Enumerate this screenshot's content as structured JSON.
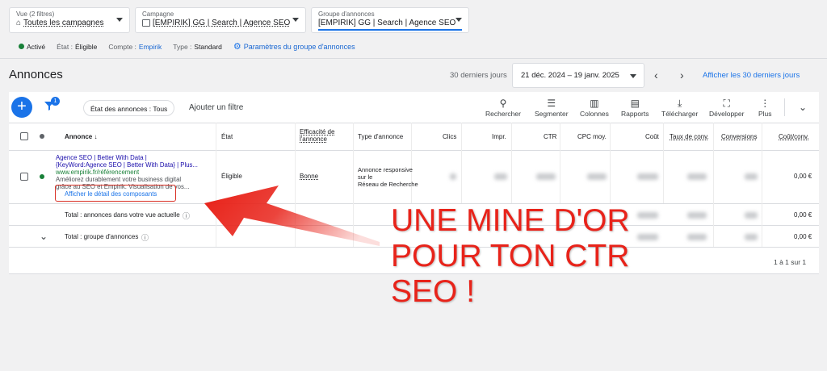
{
  "filters": {
    "view": {
      "label": "Vue (2 filtres)",
      "value": "Toutes les campagnes"
    },
    "campaign": {
      "label": "Campagne",
      "value": "[EMPIRIK] GG | Search | Agence SEO"
    },
    "adgroup": {
      "label": "Groupe d'annonces",
      "value": "[EMPIRIK] GG | Search | Agence SEO"
    }
  },
  "status_bar": {
    "active": "Activé",
    "state_label": "État :",
    "state_value": "Éligible",
    "account_label": "Compte :",
    "account_value": "Empirik",
    "type_label": "Type :",
    "type_value": "Standard",
    "settings_link": "Paramètres du groupe d'annonces"
  },
  "page_title": "Annonces",
  "date": {
    "range_label": "30 derniers jours",
    "range_value": "21 déc. 2024 – 19 janv. 2025",
    "show_last30": "Afficher les 30 derniers jours"
  },
  "toolbar": {
    "filter_badge": "1",
    "status_chip": "État des annonces : Tous",
    "add_filter": "Ajouter un filtre",
    "tools": [
      {
        "label": "Rechercher",
        "icon": "search-icon"
      },
      {
        "label": "Segmenter",
        "icon": "segment-icon"
      },
      {
        "label": "Colonnes",
        "icon": "columns-icon"
      },
      {
        "label": "Rapports",
        "icon": "reports-icon"
      },
      {
        "label": "Télécharger",
        "icon": "download-icon"
      },
      {
        "label": "Développer",
        "icon": "expand-icon"
      },
      {
        "label": "Plus",
        "icon": "more-icon"
      }
    ]
  },
  "table": {
    "headers": {
      "ad": "Annonce",
      "state": "État",
      "efficiency_1": "Efficacité de",
      "efficiency_2": "l'annonce",
      "ad_type": "Type d'annonce",
      "clicks": "Clics",
      "impr": "Impr.",
      "ctr": "CTR",
      "cpc": "CPC moy.",
      "cost": "Coût",
      "conv_rate": "Taux de conv.",
      "conversions": "Conversions",
      "cost_conv": "Coût/conv."
    },
    "row": {
      "ad_line1": "Agence SEO | Better With Data |",
      "ad_line2": "{KeyWord:Agence SEO | Better With Data} | Plus...",
      "ad_url": "www.empirik.fr/référencement",
      "ad_desc1": "Améliorez durablement votre business digital",
      "ad_desc2": "grâce au SEO et Empirik. Visualisation de vos...",
      "ad_link": "Afficher le détail des composants",
      "state": "Éligible",
      "efficiency": "Bonne",
      "type_1": "Annonce responsive",
      "type_2": "sur le",
      "type_3": "Réseau de Recherche",
      "cost_conv": "0,00 €"
    },
    "total_view": {
      "label": "Total : annonces dans votre vue actuelle",
      "cost_conv": "0,00 €"
    },
    "total_group": {
      "label": "Total : groupe d'annonces",
      "cost_conv": "0,00 €"
    },
    "pagination": "1 à 1 sur 1"
  },
  "overlay": {
    "line1": "UNE MINE D'OR",
    "line2": "POUR TON CTR",
    "line3": "SEO !"
  },
  "colors": {
    "accent": "#1a73e8",
    "active_green": "#188038",
    "overlay_red": "#e8231a"
  }
}
